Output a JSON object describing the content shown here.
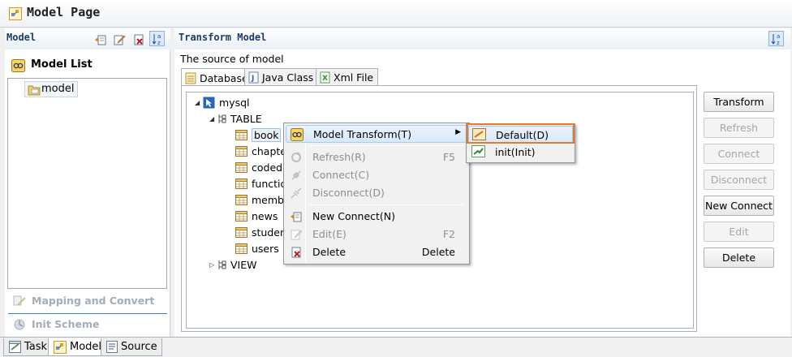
{
  "window": {
    "title": "Model Page"
  },
  "left_panel": {
    "title": "Model",
    "toolbar_icons": [
      "add-model-icon",
      "edit-icon",
      "delete-icon",
      "sort-az-icon"
    ],
    "model_list_label": "Model List",
    "tree": [
      {
        "label": "model",
        "icon": "model-folder-icon"
      }
    ],
    "nav_items": [
      {
        "label": "Mapping and Convert",
        "icon": "mapping-icon"
      },
      {
        "label": "Init Scheme",
        "icon": "init-scheme-icon"
      }
    ]
  },
  "bottom_tabs": [
    {
      "label": "Task",
      "icon": "task-icon",
      "active": false
    },
    {
      "label": "Model",
      "icon": "model-icon",
      "active": true
    },
    {
      "label": "Source",
      "icon": "source-icon",
      "active": false
    }
  ],
  "right_panel": {
    "title": "Transform Model",
    "source_label": "The source of model",
    "tabs": [
      {
        "label": "Database",
        "icon": "database-icon",
        "active": true
      },
      {
        "label": "Java Class",
        "icon": "java-class-icon",
        "active": false
      },
      {
        "label": "Xml File",
        "icon": "xml-file-icon",
        "active": false
      }
    ],
    "tree": {
      "root": "mysql",
      "table_group": "TABLE",
      "tables": [
        "book",
        "chapte",
        "codede",
        "functio",
        "membe",
        "news",
        "studen",
        "users"
      ],
      "selected_table": "book",
      "view_group": "VIEW"
    },
    "buttons": [
      {
        "label": "Transform",
        "enabled": true
      },
      {
        "label": "Refresh",
        "enabled": false
      },
      {
        "label": "Connect",
        "enabled": false
      },
      {
        "label": "Disconnect",
        "enabled": false
      },
      {
        "label": "New Connect",
        "enabled": true
      },
      {
        "label": "Edit",
        "enabled": false
      },
      {
        "label": "Delete",
        "enabled": true
      }
    ]
  },
  "context_menu": {
    "items": [
      {
        "label": "Model Transform(T)",
        "shortcut": "",
        "enabled": true,
        "submenu": true,
        "icon": "model-transform-icon"
      },
      {
        "label": "Refresh(R)",
        "shortcut": "F5",
        "enabled": false,
        "icon": "refresh-icon"
      },
      {
        "label": "Connect(C)",
        "shortcut": "",
        "enabled": false,
        "icon": "connect-icon"
      },
      {
        "label": "Disconnect(D)",
        "shortcut": "",
        "enabled": false,
        "icon": "disconnect-icon"
      },
      {
        "label": "New Connect(N)",
        "shortcut": "",
        "enabled": true,
        "icon": "new-connect-icon"
      },
      {
        "label": "Edit(E)",
        "shortcut": "F2",
        "enabled": false,
        "icon": "edit-icon"
      },
      {
        "label": "Delete",
        "shortcut": "Delete",
        "enabled": true,
        "icon": "delete-icon"
      }
    ],
    "submenu": [
      {
        "label": "Default(D)",
        "icon": "default-transform-icon",
        "highlighted": true
      },
      {
        "label": "init(Init)",
        "icon": "init-transform-icon",
        "highlighted": false
      }
    ]
  },
  "colors": {
    "panel_title": "#1b3c6a",
    "focus_outline": "#e87b2a",
    "nav_separator": "#3b7fd0",
    "disabled_text": "#a6a6a6"
  }
}
